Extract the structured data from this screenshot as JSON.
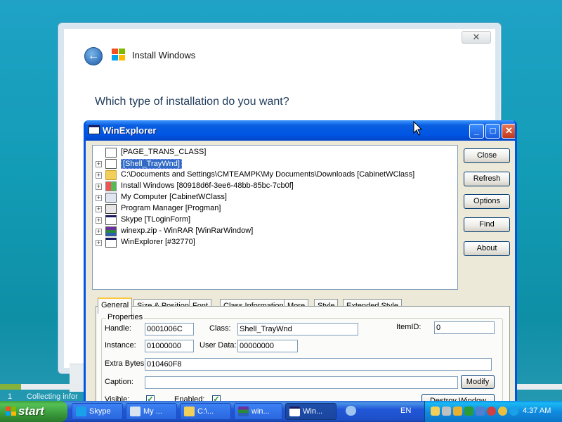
{
  "background_dialog": {
    "title": "Install Windows",
    "question": "Which type of installation do you want?",
    "close_symbol": "✕"
  },
  "status": {
    "step_number": "1",
    "text": "Collecting infor"
  },
  "winexplorer": {
    "title": "WinExplorer",
    "caption_buttons": {
      "minimize": "_",
      "maximize": "□",
      "close": "✕"
    },
    "tree": [
      {
        "label": "[PAGE_TRANS_CLASS]",
        "expandable": false,
        "icon": "blank-window-icon",
        "selected": false
      },
      {
        "label": "[Shell_TrayWnd]",
        "expandable": true,
        "icon": "blank-window-icon",
        "selected": true
      },
      {
        "label": "C:\\Documents and Settings\\CMTEAMPK\\My Documents\\Downloads [CabinetWClass]",
        "expandable": true,
        "icon": "folder-icon",
        "selected": false
      },
      {
        "label": "Install Windows [80918d6f-3ee6-48bb-85bc-7cb0f]",
        "expandable": true,
        "icon": "windows-install-icon",
        "selected": false
      },
      {
        "label": "My Computer [CabinetWClass]",
        "expandable": true,
        "icon": "computer-icon",
        "selected": false
      },
      {
        "label": "Program Manager [Progman]",
        "expandable": true,
        "icon": "program-manager-icon",
        "selected": false
      },
      {
        "label": "Skype [TLoginForm]",
        "expandable": true,
        "icon": "window-icon",
        "selected": false
      },
      {
        "label": "winexp.zip - WinRAR [WinRarWindow]",
        "expandable": true,
        "icon": "winrar-icon",
        "selected": false
      },
      {
        "label": "WinExplorer [#32770]",
        "expandable": true,
        "icon": "window-icon",
        "selected": false
      }
    ],
    "buttons": {
      "close": "Close",
      "refresh": "Refresh",
      "options": "Options",
      "find": "Find",
      "about": "About"
    },
    "tabs": [
      "General",
      "Size & Position",
      "Font",
      "Class Information",
      "More",
      "Style",
      "Extended Style"
    ],
    "active_tab": "General",
    "properties": {
      "group_label": "Properties",
      "handle_label": "Handle:",
      "handle_value": "0001006C",
      "class_label": "Class:",
      "class_value": "Shell_TrayWnd",
      "itemid_label": "ItemID:",
      "itemid_value": "0",
      "instance_label": "Instance:",
      "instance_value": "01000000",
      "userdata_label": "User Data:",
      "userdata_value": "00000000",
      "extrabytes_label": "Extra Bytes:",
      "extrabytes_value": "010460F8",
      "caption_label": "Caption:",
      "caption_value": "",
      "modify_button": "Modify",
      "visible_label": "Visible:",
      "visible_checked": true,
      "enabled_label": "Enabled:",
      "enabled_checked": true,
      "destroy_button": "Destroy Window"
    }
  },
  "taskbar": {
    "start_label": "start",
    "buttons": [
      {
        "label": "Skype",
        "icon": "skype-icon",
        "active": false
      },
      {
        "label": "My ...",
        "icon": "my-computer-icon",
        "active": false
      },
      {
        "label": "C:\\...",
        "icon": "folder-icon",
        "active": false
      },
      {
        "label": "win...",
        "icon": "winrar-icon",
        "active": false
      },
      {
        "label": "Win...",
        "icon": "winexplorer-icon",
        "active": true
      }
    ],
    "language": "EN",
    "clock": "4:37 AM",
    "colors": {
      "start_green": "#3c9e3c",
      "taskbar_blue": "#2157d7",
      "tray_blue": "#0f8ce0"
    }
  }
}
